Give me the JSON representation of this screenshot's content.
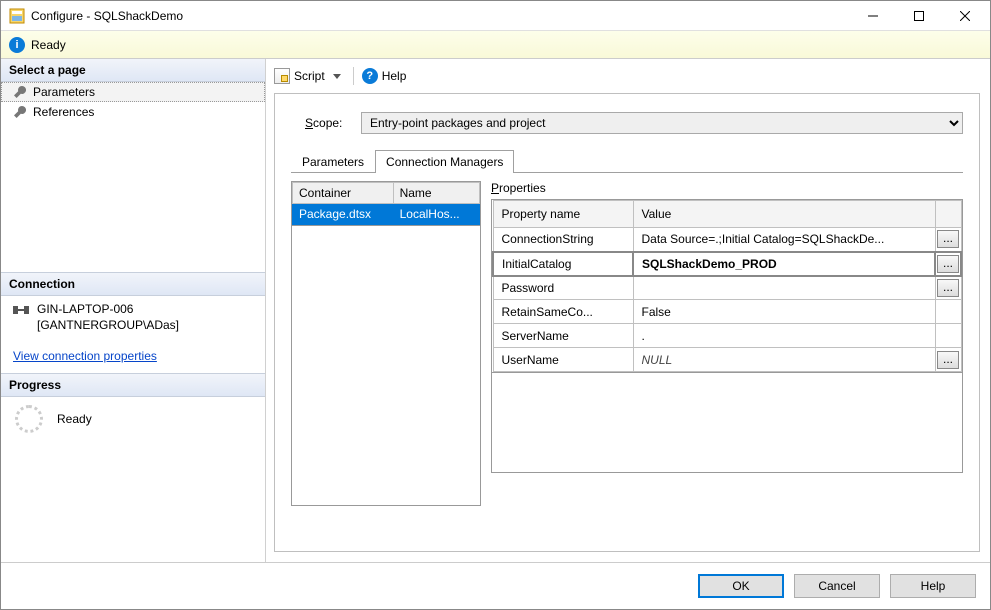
{
  "window": {
    "title": "Configure - SQLShackDemo"
  },
  "banner": {
    "text": "Ready"
  },
  "left": {
    "selectPageHeader": "Select a page",
    "pages": [
      "Parameters",
      "References"
    ],
    "connectionHeader": "Connection",
    "connectionHost": "GIN-LAPTOP-006",
    "connectionUser": "[GANTNERGROUP\\ADas]",
    "link": "View connection properties",
    "progressHeader": "Progress",
    "progressText": "Ready"
  },
  "toolbar": {
    "script": "Script",
    "help": "Help"
  },
  "scope": {
    "label": "Scope:",
    "value": "Entry-point packages and project"
  },
  "tabs": {
    "parameters": "Parameters",
    "connmgr": "Connection Managers"
  },
  "connGrid": {
    "cols": [
      "Container",
      "Name"
    ],
    "rows": [
      {
        "container": "Package.dtsx",
        "name": "LocalHos..."
      }
    ]
  },
  "props": {
    "label": "Properties",
    "cols": {
      "name": "Property name",
      "value": "Value"
    },
    "rows": [
      {
        "name": "ConnectionString",
        "value": "Data Source=.;Initial Catalog=SQLShackDe...",
        "btn": true
      },
      {
        "name": "InitialCatalog",
        "value": "SQLShackDemo_PROD",
        "btn": true,
        "bold": true,
        "sel": true
      },
      {
        "name": "Password",
        "value": "",
        "btn": true
      },
      {
        "name": "RetainSameCo...",
        "value": "False"
      },
      {
        "name": "ServerName",
        "value": "."
      },
      {
        "name": "UserName",
        "value": "NULL",
        "null": true,
        "btn": true
      }
    ]
  },
  "footer": {
    "ok": "OK",
    "cancel": "Cancel",
    "help": "Help"
  }
}
